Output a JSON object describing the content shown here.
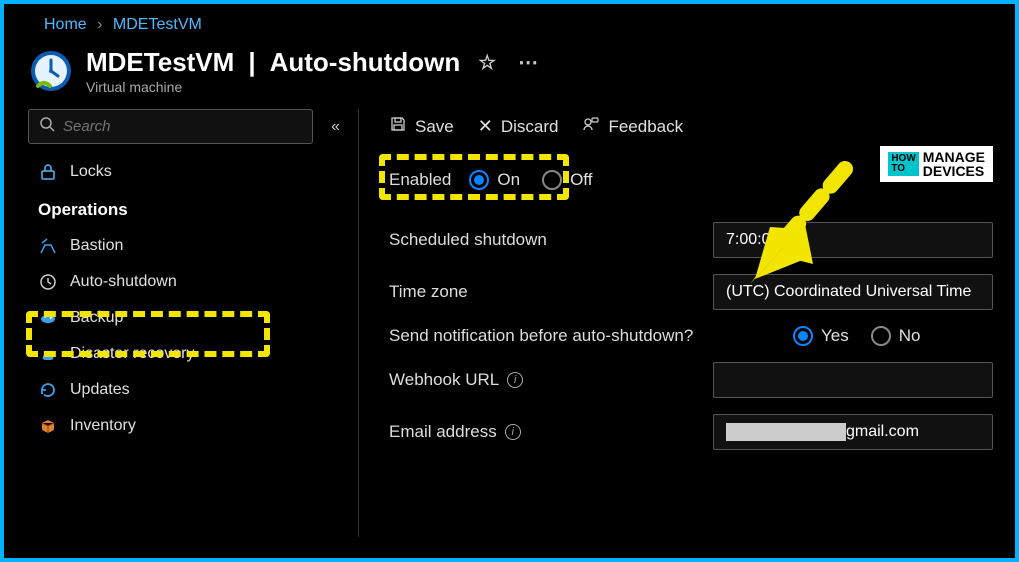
{
  "breadcrumb": {
    "home": "Home",
    "current": "MDETestVM"
  },
  "header": {
    "resource_name": "MDETestVM",
    "page_name": "Auto-shutdown",
    "resource_type": "Virtual machine"
  },
  "sidebar": {
    "search_placeholder": "Search",
    "locks": "Locks",
    "section_operations": "Operations",
    "items": {
      "bastion": "Bastion",
      "auto_shutdown": "Auto-shutdown",
      "backup": "Backup",
      "disaster_recovery": "Disaster recovery",
      "updates": "Updates",
      "inventory": "Inventory"
    }
  },
  "toolbar": {
    "save": "Save",
    "discard": "Discard",
    "feedback": "Feedback"
  },
  "form": {
    "enabled_label": "Enabled",
    "on": "On",
    "off": "Off",
    "scheduled_label": "Scheduled shutdown",
    "scheduled_value": "7:00:00 PM",
    "timezone_label": "Time zone",
    "timezone_value": "(UTC) Coordinated Universal Time",
    "notify_label": "Send notification before auto-shutdown?",
    "yes": "Yes",
    "no": "No",
    "webhook_label": "Webhook URL",
    "webhook_value": "",
    "email_label": "Email address",
    "email_suffix": "gmail.com"
  },
  "watermark": {
    "how": "HOW",
    "to": "TO",
    "line1": "MANAGE",
    "line2": "DEVICES"
  }
}
